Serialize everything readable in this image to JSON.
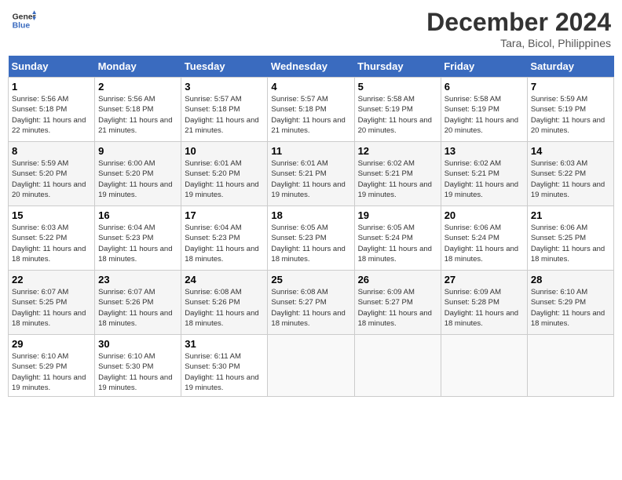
{
  "header": {
    "logo_line1": "General",
    "logo_line2": "Blue",
    "month": "December 2024",
    "location": "Tara, Bicol, Philippines"
  },
  "weekdays": [
    "Sunday",
    "Monday",
    "Tuesday",
    "Wednesday",
    "Thursday",
    "Friday",
    "Saturday"
  ],
  "weeks": [
    [
      {
        "day": "1",
        "sunrise": "5:56 AM",
        "sunset": "5:18 PM",
        "daylight": "11 hours and 22 minutes."
      },
      {
        "day": "2",
        "sunrise": "5:56 AM",
        "sunset": "5:18 PM",
        "daylight": "11 hours and 21 minutes."
      },
      {
        "day": "3",
        "sunrise": "5:57 AM",
        "sunset": "5:18 PM",
        "daylight": "11 hours and 21 minutes."
      },
      {
        "day": "4",
        "sunrise": "5:57 AM",
        "sunset": "5:18 PM",
        "daylight": "11 hours and 21 minutes."
      },
      {
        "day": "5",
        "sunrise": "5:58 AM",
        "sunset": "5:19 PM",
        "daylight": "11 hours and 20 minutes."
      },
      {
        "day": "6",
        "sunrise": "5:58 AM",
        "sunset": "5:19 PM",
        "daylight": "11 hours and 20 minutes."
      },
      {
        "day": "7",
        "sunrise": "5:59 AM",
        "sunset": "5:19 PM",
        "daylight": "11 hours and 20 minutes."
      }
    ],
    [
      {
        "day": "8",
        "sunrise": "5:59 AM",
        "sunset": "5:20 PM",
        "daylight": "11 hours and 20 minutes."
      },
      {
        "day": "9",
        "sunrise": "6:00 AM",
        "sunset": "5:20 PM",
        "daylight": "11 hours and 19 minutes."
      },
      {
        "day": "10",
        "sunrise": "6:01 AM",
        "sunset": "5:20 PM",
        "daylight": "11 hours and 19 minutes."
      },
      {
        "day": "11",
        "sunrise": "6:01 AM",
        "sunset": "5:21 PM",
        "daylight": "11 hours and 19 minutes."
      },
      {
        "day": "12",
        "sunrise": "6:02 AM",
        "sunset": "5:21 PM",
        "daylight": "11 hours and 19 minutes."
      },
      {
        "day": "13",
        "sunrise": "6:02 AM",
        "sunset": "5:21 PM",
        "daylight": "11 hours and 19 minutes."
      },
      {
        "day": "14",
        "sunrise": "6:03 AM",
        "sunset": "5:22 PM",
        "daylight": "11 hours and 19 minutes."
      }
    ],
    [
      {
        "day": "15",
        "sunrise": "6:03 AM",
        "sunset": "5:22 PM",
        "daylight": "11 hours and 18 minutes."
      },
      {
        "day": "16",
        "sunrise": "6:04 AM",
        "sunset": "5:23 PM",
        "daylight": "11 hours and 18 minutes."
      },
      {
        "day": "17",
        "sunrise": "6:04 AM",
        "sunset": "5:23 PM",
        "daylight": "11 hours and 18 minutes."
      },
      {
        "day": "18",
        "sunrise": "6:05 AM",
        "sunset": "5:23 PM",
        "daylight": "11 hours and 18 minutes."
      },
      {
        "day": "19",
        "sunrise": "6:05 AM",
        "sunset": "5:24 PM",
        "daylight": "11 hours and 18 minutes."
      },
      {
        "day": "20",
        "sunrise": "6:06 AM",
        "sunset": "5:24 PM",
        "daylight": "11 hours and 18 minutes."
      },
      {
        "day": "21",
        "sunrise": "6:06 AM",
        "sunset": "5:25 PM",
        "daylight": "11 hours and 18 minutes."
      }
    ],
    [
      {
        "day": "22",
        "sunrise": "6:07 AM",
        "sunset": "5:25 PM",
        "daylight": "11 hours and 18 minutes."
      },
      {
        "day": "23",
        "sunrise": "6:07 AM",
        "sunset": "5:26 PM",
        "daylight": "11 hours and 18 minutes."
      },
      {
        "day": "24",
        "sunrise": "6:08 AM",
        "sunset": "5:26 PM",
        "daylight": "11 hours and 18 minutes."
      },
      {
        "day": "25",
        "sunrise": "6:08 AM",
        "sunset": "5:27 PM",
        "daylight": "11 hours and 18 minutes."
      },
      {
        "day": "26",
        "sunrise": "6:09 AM",
        "sunset": "5:27 PM",
        "daylight": "11 hours and 18 minutes."
      },
      {
        "day": "27",
        "sunrise": "6:09 AM",
        "sunset": "5:28 PM",
        "daylight": "11 hours and 18 minutes."
      },
      {
        "day": "28",
        "sunrise": "6:10 AM",
        "sunset": "5:29 PM",
        "daylight": "11 hours and 18 minutes."
      }
    ],
    [
      {
        "day": "29",
        "sunrise": "6:10 AM",
        "sunset": "5:29 PM",
        "daylight": "11 hours and 19 minutes."
      },
      {
        "day": "30",
        "sunrise": "6:10 AM",
        "sunset": "5:30 PM",
        "daylight": "11 hours and 19 minutes."
      },
      {
        "day": "31",
        "sunrise": "6:11 AM",
        "sunset": "5:30 PM",
        "daylight": "11 hours and 19 minutes."
      },
      null,
      null,
      null,
      null
    ]
  ]
}
